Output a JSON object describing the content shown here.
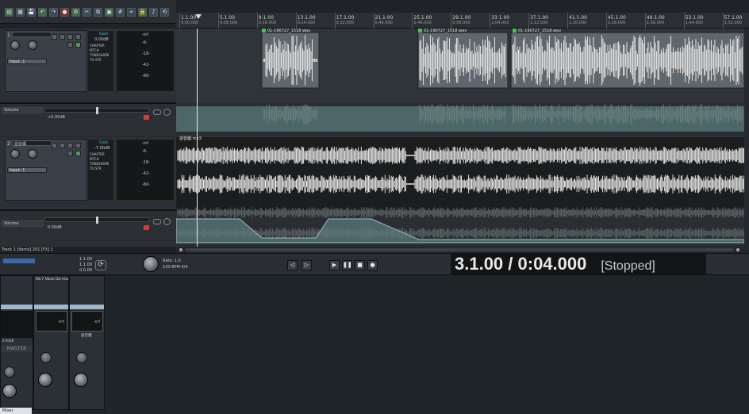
{
  "toolbar": {
    "icons": [
      "new-project",
      "open",
      "save",
      "undo",
      "redo",
      "record",
      "render",
      "cut",
      "copy",
      "paste",
      "grid",
      "snap",
      "lock",
      "metronome",
      "loop"
    ]
  },
  "ruler": {
    "marks": [
      {
        "bar": "1.1.00",
        "time": "0:00.000"
      },
      {
        "bar": "5.1.00",
        "time": "0:08.000"
      },
      {
        "bar": "9.1.00",
        "time": "0:16.000"
      },
      {
        "bar": "13.1.00",
        "time": "0:24.000"
      },
      {
        "bar": "17.1.00",
        "time": "0:32.000"
      },
      {
        "bar": "21.1.00",
        "time": "0:40.000"
      },
      {
        "bar": "25.1.00",
        "time": "0:48.000"
      },
      {
        "bar": "29.1.00",
        "time": "0:56.000"
      },
      {
        "bar": "33.1.00",
        "time": "1:04.000"
      },
      {
        "bar": "37.1.00",
        "time": "1:12.000"
      },
      {
        "bar": "41.1.00",
        "time": "1:20.000"
      },
      {
        "bar": "45.1.00",
        "time": "1:28.000"
      },
      {
        "bar": "49.1.00",
        "time": "1:36.000"
      },
      {
        "bar": "53.1.00",
        "time": "1:44.000"
      },
      {
        "bar": "57.1.00",
        "time": "1:52.000"
      }
    ]
  },
  "tracks": [
    {
      "num": "1",
      "name": "",
      "gain": "0.00dB",
      "input": "Input: 1",
      "meter_label": "Gain",
      "meter_scale": [
        "-inf",
        "-6-",
        "-18-",
        "-42-",
        "-60-"
      ],
      "fx": [
        "CHAPTER",
        "PITCH",
        "TONESHAPE",
        "TO STR"
      ]
    },
    {
      "num": "2",
      "name": "語音續",
      "gain": "-7.00dB",
      "input": "Input: 1",
      "meter_label": "Gain",
      "meter_scale": [
        "-inf",
        "-6-",
        "-18-",
        "-42-",
        "-60-"
      ],
      "fx": [
        "CHAPTER",
        "PITCH",
        "TONESHAPE",
        "TO STR"
      ]
    }
  ],
  "envelopes": [
    {
      "name": "Volume",
      "value": "+0.00dB"
    },
    {
      "name": "Volume",
      "value": "0.00dB"
    }
  ],
  "items": [
    {
      "label": "01-190727_1518.wav"
    },
    {
      "label": "01-190727_1518.wav"
    },
    {
      "label": "01-190727_1518.wav"
    },
    {
      "label": "語音續.mp3"
    }
  ],
  "status_text": "Track 1 [items] 201 [FX] 1",
  "transport": {
    "sel_start": "1.1.00",
    "sel_end": "1.1.00",
    "sel_len": "0.0.00",
    "rate_label": "Rate:",
    "rate": "1.0",
    "bpm_label": "BPM",
    "bpm": "120",
    "sig": "4/4",
    "clock": "3.1.00 / 0:04.000",
    "state": "[Stopped]"
  },
  "mixer": {
    "master_label": "MASTER",
    "master_gain": "0.00dB",
    "strip_fx": "R8.7 Voice De-mix",
    "strip_label_2": "語音續",
    "tab_label": "Mixer"
  },
  "colors": {
    "envelope_fill": "#5a7a7a",
    "waveform": "#d9d9d9",
    "item_label_icon": "#4fbf54",
    "record_button": "#d43b3b"
  }
}
